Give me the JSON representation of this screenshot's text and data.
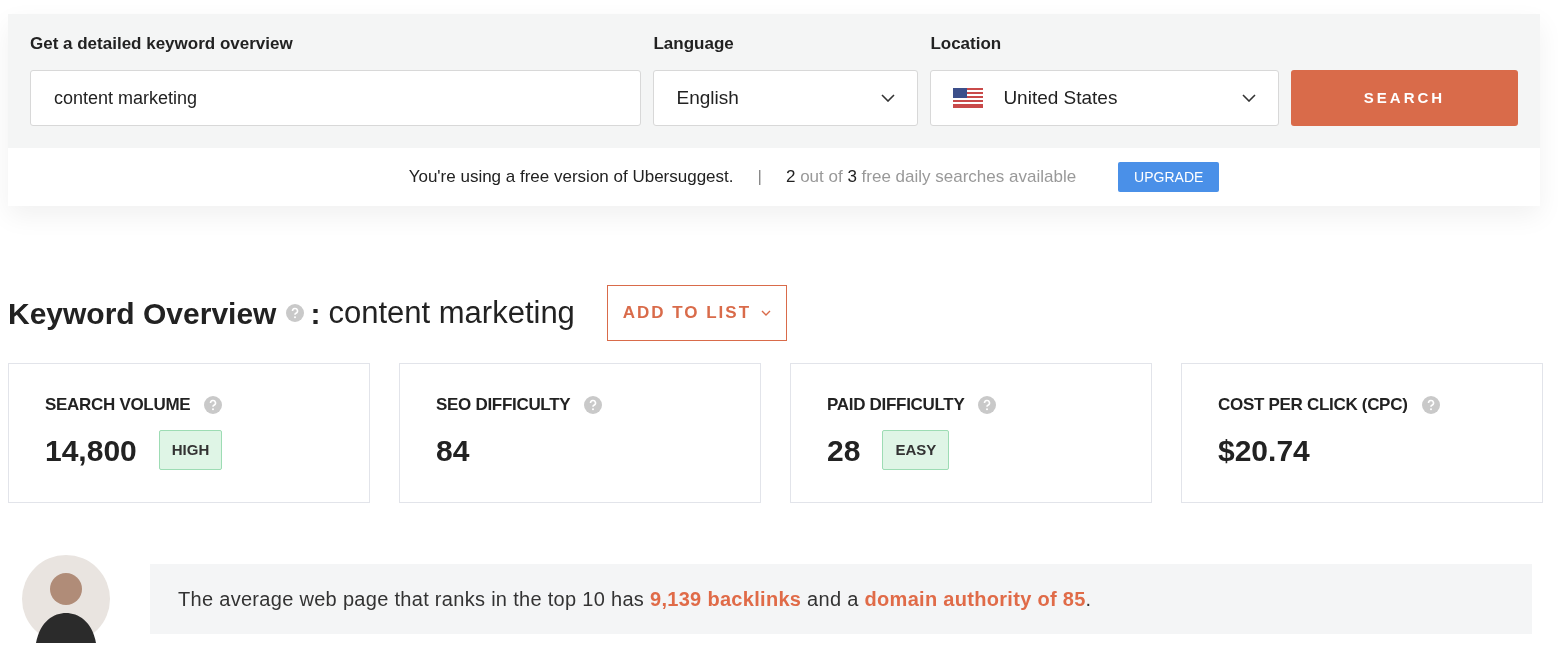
{
  "search_form": {
    "title": "Get a detailed keyword overview",
    "keyword": "content marketing",
    "language_label": "Language",
    "language": "English",
    "location_label": "Location",
    "location": "United States",
    "search_button": "SEARCH"
  },
  "notice": {
    "text": "You're using a free version of Ubersuggest.",
    "separator": "|",
    "searches": "**2** out of **3** free daily searches available",
    "upgrade_button": "UPGRADE"
  },
  "overview": {
    "title": "Keyword Overview",
    "separator": ":",
    "keyword": "content marketing",
    "add_button": "ADD TO LIST"
  },
  "metrics": [
    {
      "label": "SEARCH VOLUME",
      "value": "14,800",
      "badge": "HIGH"
    },
    {
      "label": "SEO DIFFICULTY",
      "value": "84"
    },
    {
      "label": "PAID DIFFICULTY",
      "value": "28",
      "badge": "EASY"
    },
    {
      "label": "COST PER CLICK (CPC)",
      "value": "$20.74"
    }
  ],
  "insight": {
    "text": "The average web page that ranks in the top 10 has **9,139 backlinks** and a **domain authority of 85**."
  }
}
